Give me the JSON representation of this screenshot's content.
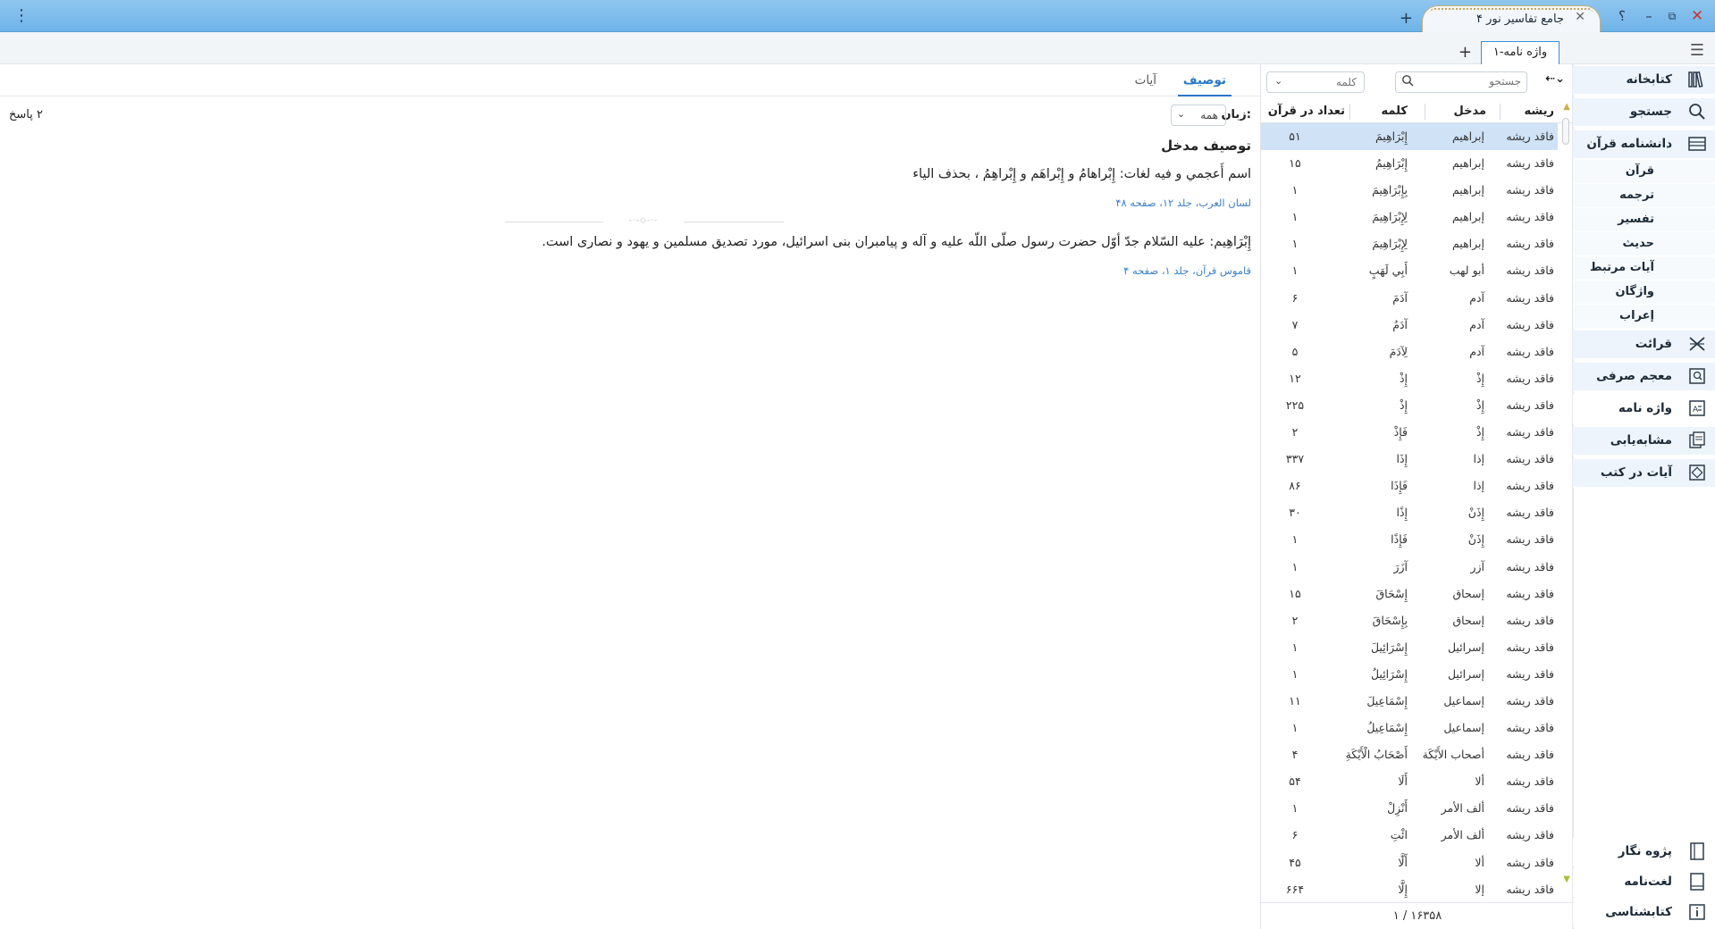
{
  "titlebar": {
    "app_title": "جامع تفاسیر نور ۴",
    "help": "؟",
    "minimize": "–",
    "restore": "⧉",
    "close": "✕",
    "tab_close": "✕",
    "new_tab": "+",
    "menu": "⋮"
  },
  "docbar": {
    "tab_label": "واژه نامه-۱",
    "new_tab": "+",
    "hamburger": "☰"
  },
  "sidebar": {
    "items": [
      {
        "label": "کتابخانه",
        "icon": "library-icon"
      },
      {
        "label": "جستجو",
        "icon": "search-icon"
      },
      {
        "label": "دانشنامه قرآن",
        "icon": "encyclopedia-icon"
      },
      {
        "label": "قرآن"
      },
      {
        "label": "ترجمه"
      },
      {
        "label": "تفسیر"
      },
      {
        "label": "حدیث"
      },
      {
        "label": "آیات مرتبط"
      },
      {
        "label": "واژگان"
      },
      {
        "label": "إعراب"
      },
      {
        "label": "قرائت",
        "icon": "swords-icon"
      },
      {
        "label": "معجم صرفی",
        "icon": "morphology-icon"
      },
      {
        "label": "واژه نامه",
        "icon": "dictionary-icon"
      },
      {
        "label": "مشابه‌یابی",
        "icon": "similarity-icon"
      },
      {
        "label": "آیات در کتب",
        "icon": "verses-in-books-icon"
      }
    ],
    "bottom": [
      {
        "label": "پژوه نگار",
        "icon": "notebook-icon"
      },
      {
        "label": "لغت‌نامه",
        "icon": "lexicon-icon"
      },
      {
        "label": "کتابشناسی",
        "icon": "info-icon"
      }
    ]
  },
  "wordlist": {
    "search_placeholder": "جستجو",
    "filter_value": "کلمه",
    "columns": {
      "root": "ریشه",
      "entry": "مدخل",
      "word": "کلمه",
      "count": "تعداد در قرآن"
    },
    "rows": [
      {
        "root": "فاقد ریشه",
        "entry": "إبراهيم",
        "word": "إِبْرَاهِيمَ",
        "count": "۵۱"
      },
      {
        "root": "فاقد ریشه",
        "entry": "إبراهيم",
        "word": "إِبْرَاهِيمُ",
        "count": "۱۵"
      },
      {
        "root": "فاقد ریشه",
        "entry": "إبراهيم",
        "word": "بِإِبْرَاهِيمَ",
        "count": "۱"
      },
      {
        "root": "فاقد ریشه",
        "entry": "إبراهيم",
        "word": "لِإِبْرَاهِيمَ",
        "count": "۱"
      },
      {
        "root": "فاقد ریشه",
        "entry": "إبراهيم",
        "word": "لِإِبْرَاهِيمَ",
        "count": "۱"
      },
      {
        "root": "فاقد ریشه",
        "entry": "أبو لهب",
        "word": "أَبِي لَهَبٍ",
        "count": "۱"
      },
      {
        "root": "فاقد ریشه",
        "entry": "آدم",
        "word": "آدَمَ",
        "count": "۶"
      },
      {
        "root": "فاقد ریشه",
        "entry": "آدم",
        "word": "آدَمُ",
        "count": "۷"
      },
      {
        "root": "فاقد ریشه",
        "entry": "آدم",
        "word": "لِآدَمَ",
        "count": "۵"
      },
      {
        "root": "فاقد ریشه",
        "entry": "إِذْ",
        "word": "إِذْ",
        "count": "۱۲"
      },
      {
        "root": "فاقد ریشه",
        "entry": "إِذْ",
        "word": "إِذْ",
        "count": "۲۲۵"
      },
      {
        "root": "فاقد ریشه",
        "entry": "إِذْ",
        "word": "فَإِذْ",
        "count": "۲"
      },
      {
        "root": "فاقد ریشه",
        "entry": "إذا",
        "word": "إِذَا",
        "count": "۳۳۷"
      },
      {
        "root": "فاقد ریشه",
        "entry": "إذا",
        "word": "فَإِذَا",
        "count": "۸۶"
      },
      {
        "root": "فاقد ریشه",
        "entry": "إِذَنْ",
        "word": "إِذًا",
        "count": "۳۰"
      },
      {
        "root": "فاقد ریشه",
        "entry": "إِذَنْ",
        "word": "فَإِذًا",
        "count": "۱"
      },
      {
        "root": "فاقد ریشه",
        "entry": "آزر",
        "word": "آزَرَ",
        "count": "۱"
      },
      {
        "root": "فاقد ریشه",
        "entry": "إسحاق",
        "word": "إِسْحَاقَ",
        "count": "۱۵"
      },
      {
        "root": "فاقد ریشه",
        "entry": "إسحاق",
        "word": "بِإِسْحَاقَ",
        "count": "۲"
      },
      {
        "root": "فاقد ریشه",
        "entry": "إسرائيل",
        "word": "إِسْرَائِيلَ",
        "count": "۱"
      },
      {
        "root": "فاقد ریشه",
        "entry": "إسرائيل",
        "word": "إِسْرَائِيلُ",
        "count": "۱"
      },
      {
        "root": "فاقد ریشه",
        "entry": "إسماعيل",
        "word": "إِسْمَاعِيلَ",
        "count": "۱۱"
      },
      {
        "root": "فاقد ریشه",
        "entry": "إسماعيل",
        "word": "إِسْمَاعِيلُ",
        "count": "۱"
      },
      {
        "root": "فاقد ریشه",
        "entry": "أصحاب الأَيْكَة",
        "word": "أَصْحَابُ الْأَيْكَةِ",
        "count": "۴"
      },
      {
        "root": "فاقد ریشه",
        "entry": "ألا",
        "word": "أَلَا",
        "count": "۵۴"
      },
      {
        "root": "فاقد ریشه",
        "entry": "ألف الأمر",
        "word": "أَنْزِلْ",
        "count": "۱"
      },
      {
        "root": "فاقد ریشه",
        "entry": "ألف الأمر",
        "word": "ائْتِ",
        "count": "۶"
      },
      {
        "root": "فاقد ریشه",
        "entry": "ألا",
        "word": "أَلَّا",
        "count": "۴۵"
      },
      {
        "root": "فاقد ریشه",
        "entry": "إلا",
        "word": "إِلَّا",
        "count": "۶۶۴"
      }
    ],
    "pager": "۱ / ۱۶۳۵۸"
  },
  "description": {
    "tabs": [
      "توصیف",
      "آیات"
    ],
    "language_label": "زبان:",
    "language_value": "همه",
    "answers": "۲ پاسخ",
    "title": "توصیف مدخل",
    "entries": [
      {
        "text": "اسم أَعجمي و فيه لغات: إِبْراهامُ و إِبْراهَم و إِبْراهِمُ ، بحذف الياء",
        "source": "لسان العرب، جلد ۱۲، صفحه ۴۸"
      },
      {
        "text": "إِبْرَاهِيم: عليه السّلام جدّ أوّل حضرت رسول صلّى اللّه عليه و آله و پيامبران بنى اسرائيل، مورد تصديق مسلمين و يهود و نصارى است.",
        "source": "قاموس قرآن، جلد ۱، صفحه ۴"
      }
    ]
  }
}
